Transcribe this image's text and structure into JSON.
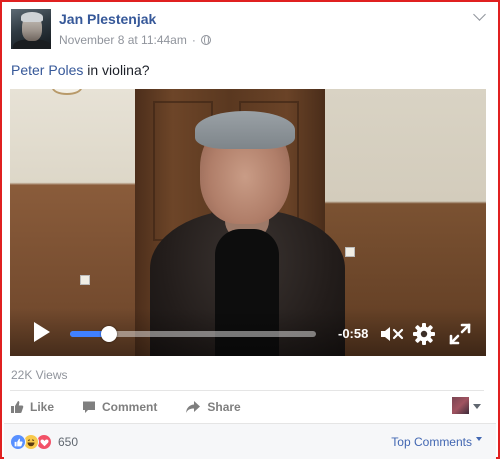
{
  "post": {
    "author": "Jan Plestenjak",
    "timestamp": "November 8 at 11:44am",
    "separator": "·",
    "privacy_icon": "globe-icon",
    "menu_icon": "chevron-down-icon",
    "text_mention": "Peter Poles",
    "text_rest": " in violina?"
  },
  "video": {
    "progress": 0.16,
    "time_remaining": "-0:58",
    "controls": [
      "play-icon",
      "mute-icon",
      "settings-gear-icon",
      "fullscreen-icon"
    ],
    "accent_color": "#4080ff"
  },
  "stats": {
    "views": "22K Views"
  },
  "actions": {
    "like": "Like",
    "comment": "Comment",
    "share": "Share"
  },
  "footer": {
    "reaction_icons": [
      "like-reaction-icon",
      "haha-reaction-icon",
      "love-reaction-icon"
    ],
    "reaction_count": "650",
    "top_comments": "Top Comments"
  },
  "colors": {
    "link": "#365899",
    "border": "#e02020",
    "muted": "#90949c"
  }
}
